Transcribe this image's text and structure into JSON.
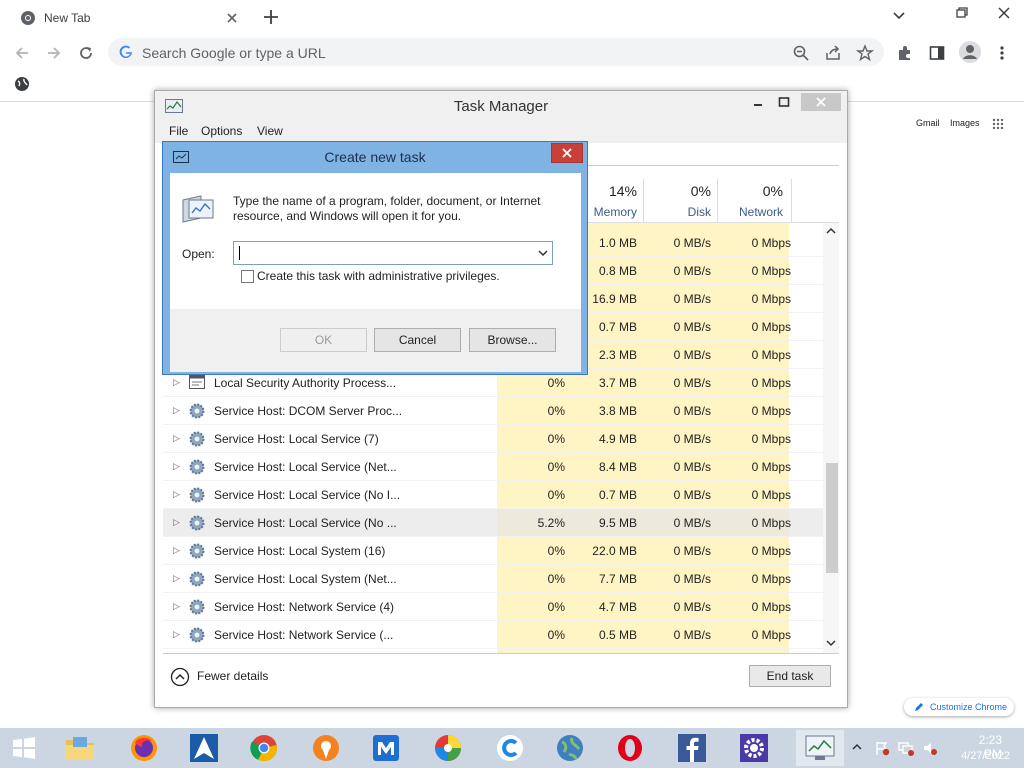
{
  "browser": {
    "tab_title": "New Tab",
    "omnibox_placeholder": "Search Google or type a URL",
    "ntp_links": {
      "gmail": "Gmail",
      "images": "Images"
    },
    "customize_label": "Customize Chrome"
  },
  "task_manager": {
    "title": "Task Manager",
    "menu": [
      "File",
      "Options",
      "View"
    ],
    "columns": [
      {
        "percent": "14%",
        "label": "Memory"
      },
      {
        "percent": "0%",
        "label": "Disk"
      },
      {
        "percent": "0%",
        "label": "Network"
      }
    ],
    "rows": [
      {
        "name": "",
        "cpu": "",
        "memory": "1.0 MB",
        "disk": "0 MB/s",
        "network": "0 Mbps",
        "icon": "service-gear-icon"
      },
      {
        "name": "",
        "cpu": "",
        "memory": "0.8 MB",
        "disk": "0 MB/s",
        "network": "0 Mbps",
        "icon": "service-gear-icon"
      },
      {
        "name": "",
        "cpu": "",
        "memory": "16.9 MB",
        "disk": "0 MB/s",
        "network": "0 Mbps",
        "icon": "service-gear-icon"
      },
      {
        "name": "",
        "cpu": "",
        "memory": "0.7 MB",
        "disk": "0 MB/s",
        "network": "0 Mbps",
        "icon": "service-gear-icon"
      },
      {
        "name": "",
        "cpu": "",
        "memory": "2.3 MB",
        "disk": "0 MB/s",
        "network": "0 Mbps",
        "icon": "service-gear-icon"
      },
      {
        "name": "Local Security Authority Process...",
        "cpu": "0%",
        "memory": "3.7 MB",
        "disk": "0 MB/s",
        "network": "0 Mbps",
        "icon": "window-process-icon"
      },
      {
        "name": "Service Host: DCOM Server Proc...",
        "cpu": "0%",
        "memory": "3.8 MB",
        "disk": "0 MB/s",
        "network": "0 Mbps",
        "icon": "service-gear-icon"
      },
      {
        "name": "Service Host: Local Service (7)",
        "cpu": "0%",
        "memory": "4.9 MB",
        "disk": "0 MB/s",
        "network": "0 Mbps",
        "icon": "service-gear-icon"
      },
      {
        "name": "Service Host: Local Service (Net...",
        "cpu": "0%",
        "memory": "8.4 MB",
        "disk": "0 MB/s",
        "network": "0 Mbps",
        "icon": "service-gear-icon"
      },
      {
        "name": "Service Host: Local Service (No I...",
        "cpu": "0%",
        "memory": "0.7 MB",
        "disk": "0 MB/s",
        "network": "0 Mbps",
        "icon": "service-gear-icon"
      },
      {
        "name": "Service Host: Local Service (No ...",
        "cpu": "5.2%",
        "memory": "9.5 MB",
        "disk": "0 MB/s",
        "network": "0 Mbps",
        "icon": "service-gear-icon",
        "highlighted": true
      },
      {
        "name": "Service Host: Local System (16)",
        "cpu": "0%",
        "memory": "22.0 MB",
        "disk": "0 MB/s",
        "network": "0 Mbps",
        "icon": "service-gear-icon"
      },
      {
        "name": "Service Host: Local System (Net...",
        "cpu": "0%",
        "memory": "7.7 MB",
        "disk": "0 MB/s",
        "network": "0 Mbps",
        "icon": "service-gear-icon"
      },
      {
        "name": "Service Host: Network Service (4)",
        "cpu": "0%",
        "memory": "4.7 MB",
        "disk": "0 MB/s",
        "network": "0 Mbps",
        "icon": "service-gear-icon"
      },
      {
        "name": "Service Host: Network Service (...",
        "cpu": "0%",
        "memory": "0.5 MB",
        "disk": "0 MB/s",
        "network": "0 Mbps",
        "icon": "service-gear-icon"
      }
    ],
    "fewer_details": "Fewer details",
    "end_task": "End task"
  },
  "dialog": {
    "title": "Create new task",
    "message": "Type the name of a program, folder, document, or Internet resource, and Windows will open it for you.",
    "open_label": "Open:",
    "open_value": "",
    "admin_checkbox_label": "Create this task with administrative privileges.",
    "buttons": {
      "ok": "OK",
      "cancel": "Cancel",
      "browse": "Browse..."
    }
  },
  "taskbar": {
    "icons": [
      "start-icon",
      "file-explorer-icon",
      "firefox-icon",
      "arch-linux-icon",
      "chrome-icon",
      "avast-icon",
      "maxthon-icon",
      "picasa-icon",
      "ccleaner-icon",
      "globe-icon",
      "opera-icon",
      "facebook-icon",
      "settings-gear-icon",
      "task-manager-icon"
    ],
    "clock_time": "2:23 PM",
    "clock_date": "4/27/2022"
  },
  "colors": {
    "memory_highlight": "#fff4c4",
    "dialog_frame": "#7fb3e4",
    "dialog_close": "#c7413a",
    "taskbar": "#cbd6e2"
  }
}
